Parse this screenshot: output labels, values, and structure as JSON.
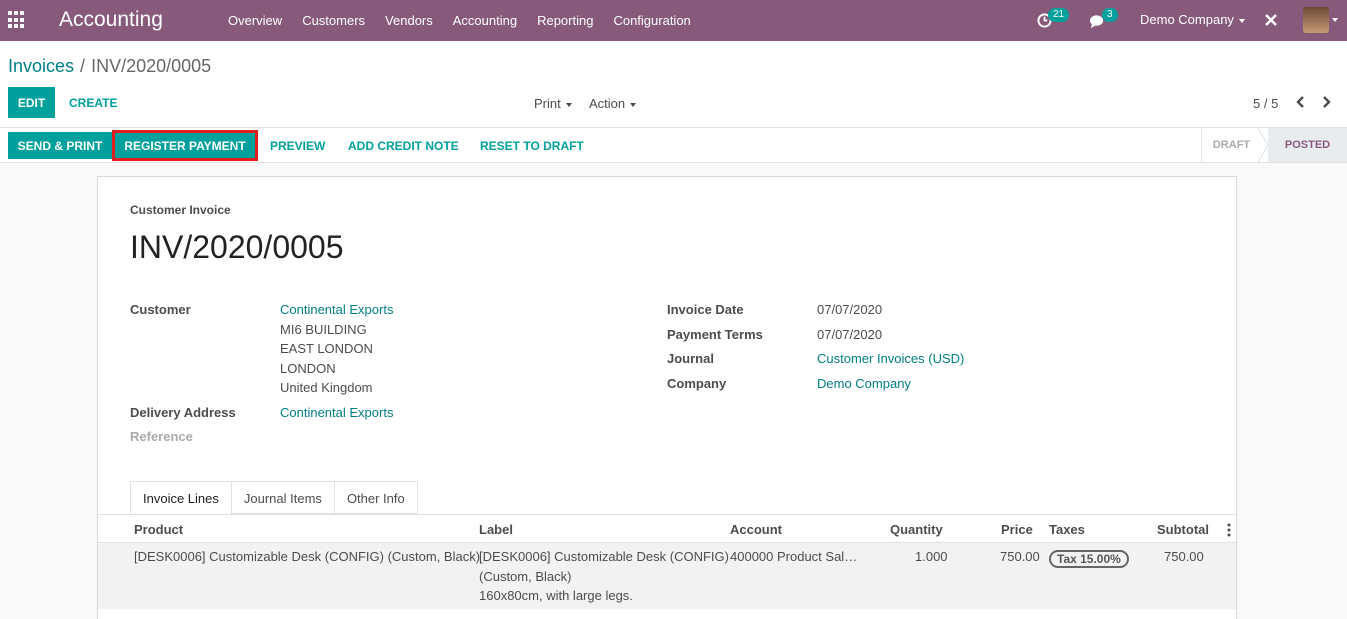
{
  "navbar": {
    "brand": "Accounting",
    "menu": [
      "Overview",
      "Customers",
      "Vendors",
      "Accounting",
      "Reporting",
      "Configuration"
    ],
    "activity_count": "21",
    "message_count": "3",
    "company": "Demo Company"
  },
  "breadcrumb": {
    "parent": "Invoices",
    "current": "INV/2020/0005"
  },
  "buttons": {
    "edit": "EDIT",
    "create": "CREATE",
    "print": "Print",
    "action": "Action"
  },
  "pager": {
    "value": "5 / 5"
  },
  "statusbar": {
    "actions": [
      "SEND & PRINT",
      "REGISTER PAYMENT",
      "PREVIEW",
      "ADD CREDIT NOTE",
      "RESET TO DRAFT"
    ],
    "stages": [
      "DRAFT",
      "POSTED"
    ],
    "current_stage": "POSTED"
  },
  "invoice": {
    "type_label": "Customer Invoice",
    "number": "INV/2020/0005",
    "customer_label": "Customer",
    "customer_name": "Continental Exports",
    "address_lines": [
      "MI6 BUILDING",
      "EAST LONDON",
      "LONDON",
      "United Kingdom"
    ],
    "delivery_label": "Delivery Address",
    "delivery_value": "Continental Exports",
    "reference_label": "Reference",
    "invoice_date_label": "Invoice Date",
    "invoice_date": "07/07/2020",
    "payment_terms_label": "Payment Terms",
    "payment_terms": "07/07/2020",
    "journal_label": "Journal",
    "journal": "Customer Invoices (USD)",
    "company_label": "Company",
    "company": "Demo Company"
  },
  "tabs": [
    "Invoice Lines",
    "Journal Items",
    "Other Info"
  ],
  "lines": {
    "headers": [
      "Product",
      "Label",
      "Account",
      "Quantity",
      "Price",
      "Taxes",
      "Subtotal"
    ],
    "rows": [
      {
        "product": "[DESK0006] Customizable Desk (CONFIG) (Custom, Black)",
        "label_1": "[DESK0006] Customizable Desk (CONFIG)",
        "label_2": "(Custom, Black)",
        "label_3": "160x80cm, with large legs.",
        "account": "400000 Product Sal…",
        "quantity": "1.000",
        "price": "750.00",
        "tax": "Tax 15.00%",
        "subtotal": "750.00"
      }
    ]
  }
}
